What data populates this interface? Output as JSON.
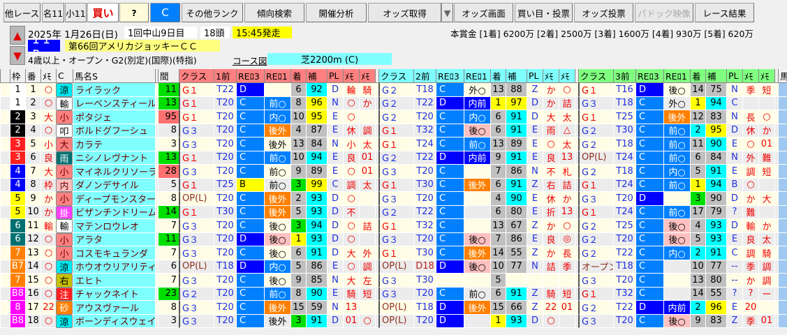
{
  "toolbar": [
    "他レース",
    "名11",
    "小11",
    "買い",
    "?",
    "C",
    "その他ランク",
    "傾向検索",
    "開催分析",
    "オッズ取得",
    "▼",
    "オッズ画面",
    "買い目・投票",
    "オッズ投票",
    "パドック映像",
    "レース結果"
  ],
  "info": {
    "date": "2025年  1月26日(日)",
    "meeting": "1回中山9日目",
    "runners": "18頭",
    "post_time": "15:45発走",
    "race_no": "１１Ｒ",
    "race_name": "第66回アメリカジョッキーＣＣ",
    "conditions": "4歳以上・オープン・G2(別定)(国際)(特指)",
    "course_link": "コース図",
    "course": "芝2200m (C)",
    "prize": "本賞金 [1着] 6200万 [2着] 2500万 [3着] 1600万 [4着] 930万 [5着] 620万"
  },
  "headers": {
    "fixed": [
      "枠",
      "番",
      "ﾒﾓ",
      "C",
      "馬名S",
      "間"
    ],
    "blocks": [
      [
        "クラス",
        "1前",
        "REﾛ3",
        "REﾛ1",
        "着",
        "補",
        "PL",
        "ﾒﾓ",
        "ﾒﾓ"
      ],
      [
        "クラス",
        "2前",
        "REﾛ3",
        "REﾛ1",
        "着",
        "補",
        "PL",
        "ﾒﾓ",
        "ﾒﾓ"
      ],
      [
        "クラス",
        "3前",
        "REﾛ3",
        "REﾛ1",
        "着",
        "補",
        "PL",
        "ﾒﾓ",
        "ﾒﾓ"
      ]
    ],
    "tail": "馬"
  },
  "colors": {
    "waku": {
      "1": "#ffffff",
      "2": "#000000",
      "3": "#ff2020",
      "4": "#0000ff",
      "5": "#ffff00",
      "6": "#007070",
      "7": "#ff8000",
      "8": "#ff00ff"
    }
  },
  "rows": [
    {
      "waku": "1",
      "wk": "1",
      "num": "1",
      "mark": "○",
      "c": "涼",
      "cs": "cy",
      "name": "ライラック",
      "iv": "11",
      "ivs": "G",
      "races": [
        [
          "G１",
          "T22",
          "D",
          "",
          "",
          "6",
          "g",
          "92",
          "c",
          "D",
          "輪",
          "騎"
        ],
        [
          "G２",
          "T18",
          "C",
          "外○",
          "",
          "13",
          "g",
          "88",
          "g",
          "Z",
          "か",
          "○"
        ],
        [
          "G１",
          "T16",
          "D",
          "後○",
          "",
          "14",
          "g",
          "75",
          "g",
          "N",
          "季",
          "短"
        ]
      ]
    },
    {
      "waku": "1",
      "wk": "1",
      "num": "2",
      "mark": "○",
      "c": "輸",
      "cs": "w",
      "name": "レーベンスティール",
      "iv": "13",
      "ivs": "G",
      "races": [
        [
          "G１",
          "T20",
          "C",
          "前○",
          "b",
          "8",
          "g",
          "96",
          "y",
          "N",
          "○",
          "か"
        ],
        [
          "G２",
          "T22",
          "D",
          "内前",
          "n",
          "1",
          "y",
          "97",
          "y",
          "D",
          "か",
          "詰"
        ],
        [
          "G３",
          "T18",
          "C",
          "外○",
          "",
          "1",
          "y",
          "94",
          "c",
          "C",
          "",
          ""
        ]
      ]
    },
    {
      "waku": "2",
      "wk": "2",
      "num": "3",
      "mark": "大",
      "c": "小",
      "cs": "pk",
      "name": "ポタジェ",
      "iv": "95",
      "ivs": "R",
      "races": [
        [
          "G１",
          "T20",
          "C",
          "内○",
          "b",
          "10",
          "g",
          "95",
          "y",
          "E",
          "○",
          ""
        ],
        [
          "G２",
          "T20",
          "C",
          "内○",
          "b",
          "6",
          "g",
          "91",
          "c",
          "D",
          "大",
          "太"
        ],
        [
          "G１",
          "T25",
          "C",
          "後外",
          "o",
          "12",
          "g",
          "83",
          "g",
          "N",
          "長",
          "○"
        ]
      ]
    },
    {
      "waku": "2",
      "wk": "2",
      "num": "4",
      "mark": "○",
      "c": "叩",
      "cs": "w",
      "name": "ボルドグフーシュ",
      "iv": "8",
      "ivs": "",
      "races": [
        [
          "G３",
          "T20",
          "C",
          "後外",
          "o",
          "4",
          "g",
          "87",
          "g",
          "E",
          "休",
          "調"
        ],
        [
          "G１",
          "T32",
          "C",
          "後○",
          "p",
          "6",
          "g",
          "91",
          "c",
          "E",
          "雨",
          "△"
        ],
        [
          "G２",
          "T30",
          "C",
          "前○",
          "b",
          "2",
          "c",
          "95",
          "y",
          "D",
          "休",
          "か"
        ]
      ]
    },
    {
      "waku": "3",
      "wk": "3",
      "num": "5",
      "mark": "小",
      "c": "大",
      "cs": "pk",
      "name": "カラテ",
      "iv": "3",
      "ivs": "",
      "races": [
        [
          "G３",
          "T20",
          "C",
          "後外",
          "",
          "13",
          "g",
          "84",
          "g",
          "N",
          "小",
          "太"
        ],
        [
          "G１",
          "T24",
          "C",
          "前○",
          "b",
          "13",
          "g",
          "89",
          "g",
          "E",
          "○",
          "太"
        ],
        [
          "G２",
          "T18",
          "C",
          "前○",
          "b",
          "11",
          "g",
          "90",
          "c",
          "E",
          "○",
          "01"
        ]
      ]
    },
    {
      "waku": "3",
      "wk": "3",
      "num": "6",
      "mark": "良",
      "c": "雨",
      "cs": "tl",
      "name": "ニシノレヴナント",
      "iv": "13",
      "ivs": "G",
      "races": [
        [
          "G１",
          "T20",
          "C",
          "前○",
          "b",
          "10",
          "g",
          "94",
          "c",
          "E",
          "良",
          "01"
        ],
        [
          "G２",
          "T22",
          "D",
          "内前",
          "n",
          "9",
          "g",
          "91",
          "c",
          "E",
          "良",
          "13"
        ],
        [
          "OP(L)",
          "T24",
          "C",
          "前○",
          "b",
          "6",
          "g",
          "84",
          "g",
          "N",
          "外",
          "難"
        ]
      ]
    },
    {
      "waku": "4",
      "wk": "4",
      "num": "7",
      "mark": "大",
      "c": "小",
      "cs": "pk",
      "name": "マイネルクリソーラ",
      "iv": "28",
      "ivs": "R",
      "races": [
        [
          "G３",
          "T20",
          "C",
          "前○",
          "",
          "9",
          "g",
          "89",
          "g",
          "E",
          "○",
          "01"
        ],
        [
          "G３",
          "T20",
          "C",
          "",
          "",
          "7",
          "g",
          "86",
          "g",
          "N",
          "不",
          "札"
        ],
        [
          "G２",
          "T18",
          "C",
          "内○",
          "b",
          "5",
          "g",
          "91",
          "c",
          "E",
          "調",
          "短"
        ]
      ]
    },
    {
      "waku": "4",
      "wk": "4",
      "num": "8",
      "mark": "枠",
      "c": "内",
      "cs": "lp",
      "name": "ダノンデサイル",
      "iv": "5",
      "ivs": "",
      "races": [
        [
          "G１",
          "T25",
          "B",
          "前○",
          "",
          "3",
          "G",
          "99",
          "y",
          "C",
          "調",
          "太"
        ],
        [
          "G１",
          "T30",
          "C",
          "後外",
          "o",
          "6",
          "g",
          "91",
          "c",
          "Z",
          "右",
          "詰"
        ],
        [
          "G１",
          "T24",
          "C",
          "前○",
          "b",
          "1",
          "y",
          "94",
          "c",
          "B",
          "○",
          ""
        ]
      ]
    },
    {
      "waku": "5",
      "wk": "5",
      "num": "9",
      "mark": "か",
      "c": "小",
      "cs": "pk",
      "name": "ディープモンスター",
      "iv": "8",
      "ivs": "",
      "races": [
        [
          "OP(L)",
          "T20",
          "C",
          "後外",
          "o",
          "2",
          "g",
          "93",
          "c",
          "D",
          "○",
          ""
        ],
        [
          "G３",
          "T20",
          "C",
          "",
          "",
          "4",
          "g",
          "90",
          "c",
          "E",
          "休",
          "か"
        ],
        [
          "G３",
          "T20",
          "D",
          "",
          "",
          "3",
          "G",
          "90",
          "g",
          "D",
          "か",
          "大"
        ]
      ]
    },
    {
      "waku": "5",
      "wk": "5",
      "num": "10",
      "mark": "か",
      "c": "掛",
      "cs": "mg",
      "name": "ビザンチンドリーム",
      "iv": "14",
      "ivs": "G",
      "races": [
        [
          "G１",
          "T30",
          "C",
          "後外",
          "o",
          "5",
          "g",
          "93",
          "c",
          "D",
          "不",
          ""
        ],
        [
          "G２",
          "T22",
          "C",
          "",
          "",
          "6",
          "g",
          "80",
          "g",
          "E",
          "折",
          "13"
        ],
        [
          "G１",
          "T24",
          "C",
          "前○",
          "b",
          "17",
          "g",
          "79",
          "g",
          "?",
          "難",
          ""
        ]
      ]
    },
    {
      "waku": "6",
      "wk": "6",
      "num": "11",
      "mark": "輸",
      "c": "輸",
      "cs": "w",
      "name": "マテンロウレオ",
      "iv": "7",
      "ivs": "",
      "races": [
        [
          "G３",
          "T20",
          "C",
          "後○",
          "",
          "3",
          "G",
          "94",
          "c",
          "D",
          "○",
          "詰"
        ],
        [
          "G１",
          "T32",
          "C",
          "",
          "",
          "13",
          "g",
          "67",
          "g",
          "Z",
          "か",
          "○"
        ],
        [
          "G２",
          "T25",
          "C",
          "後○",
          "p",
          "4",
          "g",
          "93",
          "c",
          "D",
          "輸",
          "か"
        ]
      ]
    },
    {
      "waku": "6",
      "wk": "6",
      "num": "12",
      "mark": "○",
      "c": "小",
      "cs": "pk",
      "name": "アラタ",
      "iv": "11",
      "ivs": "G",
      "races": [
        [
          "G３",
          "T20",
          "D",
          "後○",
          "p",
          "1",
          "y",
          "93",
          "c",
          "D",
          "○",
          ""
        ],
        [
          "G３",
          "T20",
          "C",
          "後○",
          "p",
          "7",
          "g",
          "86",
          "g",
          "E",
          "良",
          "◎"
        ],
        [
          "G２",
          "T20",
          "C",
          "後○",
          "p",
          "5",
          "g",
          "93",
          "c",
          "E",
          "良",
          "太"
        ]
      ]
    },
    {
      "waku": "7",
      "wk": "7",
      "num": "13",
      "mark": "○",
      "c": "小",
      "cs": "pk",
      "name": "コスモキュランダ",
      "iv": "7",
      "ivs": "",
      "races": [
        [
          "G３",
          "T20",
          "C",
          "後○",
          "",
          "6",
          "g",
          "91",
          "c",
          "D",
          "大",
          "外"
        ],
        [
          "G１",
          "T30",
          "C",
          "後外",
          "o",
          "14",
          "g",
          "55",
          "g",
          "Z",
          "か",
          "長"
        ],
        [
          "G２",
          "T22",
          "C",
          "内○",
          "b",
          "2",
          "c",
          "91",
          "c",
          "C",
          "調",
          "騎"
        ]
      ]
    },
    {
      "waku": "B7",
      "wk": "7",
      "num": "14",
      "mark": "○",
      "c": "涼",
      "cs": "cy",
      "name": "ホウオウリアリティ",
      "iv": "6",
      "ivs": "",
      "races": [
        [
          "OP(L)",
          "T18",
          "D",
          "内○",
          "b",
          "5",
          "g",
          "86",
          "g",
          "E",
          "○",
          "調"
        ],
        [
          "OP(L)",
          "D18",
          "D",
          "後○",
          "p",
          "10",
          "g",
          "77",
          "g",
          "N",
          "詰",
          "季"
        ],
        [
          "オープン",
          "T18",
          "C",
          "",
          "",
          "10",
          "g",
          "77",
          "g",
          "--",
          "季",
          "調"
        ]
      ]
    },
    {
      "waku": "7",
      "wk": "7",
      "num": "15",
      "mark": "○",
      "c": "右",
      "cs": "ol",
      "name": "エヒト",
      "iv": "7",
      "ivs": "",
      "races": [
        [
          "G３",
          "T20",
          "C",
          "後○",
          "",
          "9",
          "g",
          "85",
          "g",
          "N",
          "大",
          "左"
        ],
        [
          "G３",
          "T30",
          "",
          "",
          "",
          "5",
          "g",
          "",
          "",
          "",
          "",
          ""
        ],
        [
          "G３",
          "T20",
          "C",
          "",
          "",
          "13",
          "g",
          "80",
          "g",
          "--",
          "か",
          "調"
        ]
      ]
    },
    {
      "waku": "B8",
      "wk": "8",
      "num": "16",
      "mark": "○",
      "c": "注",
      "cs": "rd",
      "name": "チャックネイト",
      "iv": "23",
      "ivs": "G",
      "races": [
        [
          "G２",
          "T20",
          "C",
          "前○",
          "b",
          "8",
          "g",
          "90",
          "c",
          "E",
          "騎",
          "短"
        ],
        [
          "G３",
          "T20",
          "C",
          "前○",
          "",
          "6",
          "g",
          "91",
          "c",
          "Z",
          "騎",
          "短"
        ],
        [
          "G１",
          "T32",
          "C",
          "",
          "",
          "14",
          "g",
          "55",
          "g",
          "?",
          "?",
          "ー"
        ]
      ]
    },
    {
      "waku": "8",
      "wk": "8",
      "num": "17",
      "mark": "22",
      "c": "砂",
      "cs": "or",
      "name": "アウスヴァール",
      "iv": "8",
      "ivs": "",
      "races": [
        [
          "G３",
          "T20",
          "C",
          "後外",
          "o",
          "15",
          "g",
          "59",
          "g",
          "N",
          "13",
          ""
        ],
        [
          "OP(L)",
          "T18",
          "D",
          "後外",
          "o",
          "15",
          "g",
          "66",
          "g",
          "Z",
          "22",
          "01"
        ],
        [
          "G２",
          "T22",
          "D",
          "内前",
          "n",
          "2",
          "c",
          "96",
          "y",
          "E",
          "20",
          ""
        ]
      ]
    },
    {
      "waku": "B8",
      "wk": "8",
      "num": "18",
      "mark": "○",
      "c": "涼",
      "cs": "cy",
      "name": "ボーンディスウェイ",
      "iv": "3",
      "ivs": "",
      "races": [
        [
          "G３",
          "T20",
          "C",
          "後外",
          "",
          "3",
          "G",
          "91",
          "c",
          "D",
          "01",
          "○"
        ],
        [
          "OP(L)",
          "T20",
          "D",
          "",
          "",
          "1",
          "y",
          "93",
          "c",
          "D",
          "○",
          ""
        ],
        [
          "G３",
          "T20",
          "C",
          "後○",
          "p",
          "9",
          "g",
          "83",
          "g",
          "Z",
          "季",
          "01"
        ]
      ]
    }
  ]
}
